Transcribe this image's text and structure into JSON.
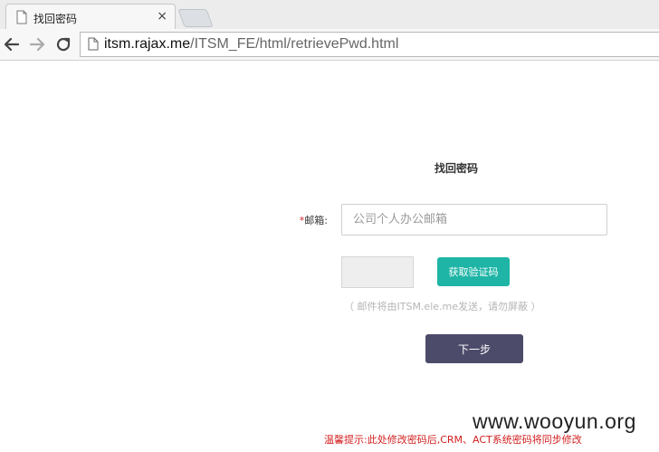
{
  "browser": {
    "tab_title": "找回密码",
    "tab_close": "×",
    "url_host": "itsm.rajax.me",
    "url_path": "/ITSM_FE/html/retrievePwd.html"
  },
  "form": {
    "title": "找回密码",
    "email_label_star": "*",
    "email_label": "邮箱:",
    "email_placeholder": "公司个人办公邮箱",
    "get_code_label": "获取验证码",
    "hint": "（ 邮件将由ITSM.ele.me发送，请勿屏蔽 ）",
    "next_label": "下一步"
  },
  "footer": {
    "warning": "温馨提示:此处修改密码后,CRM、ACT系统密码将同步修改"
  },
  "watermark": "www.wooyun.org",
  "colors": {
    "accent_teal": "#1fb5a6",
    "next_button": "#4d4b6a",
    "warning_red": "#d21f1f"
  },
  "icons": [
    "page-icon",
    "back-arrow-icon",
    "forward-arrow-icon",
    "reload-icon",
    "close-icon"
  ]
}
